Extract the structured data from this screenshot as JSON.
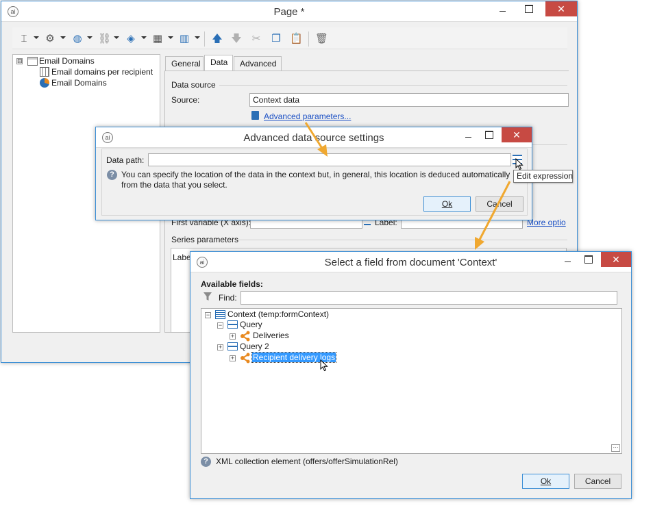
{
  "page_window": {
    "title": "Page *",
    "close_glyph": "✕",
    "tree": [
      {
        "label": "Email Domains",
        "icon": "page-icon",
        "expander": "⊟"
      },
      {
        "label": "Email domains per recipient",
        "icon": "table-icon"
      },
      {
        "label": "Email Domains",
        "icon": "pie-chart-icon"
      }
    ],
    "tabs": [
      "General",
      "Data",
      "Advanced"
    ],
    "data_source_section": "Data source",
    "source_label": "Source:",
    "source_value": "Context data",
    "advanced_link": "Advanced parameters...",
    "first_variable_label": "First variable (X axis):",
    "label_label": "Label:",
    "more_options": "More optio",
    "series_section": "Series parameters",
    "series_column": "Label"
  },
  "advanced_dialog": {
    "title": "Advanced data source settings",
    "data_path_label": "Data path:",
    "data_path_value": "",
    "help_text_1": "You can specify the location of the data in the context but, in general, this location is deduced automatically",
    "help_text_2": "from the data that you select.",
    "ok": "Ok",
    "cancel": "Cancel",
    "tooltip": "Edit expression"
  },
  "field_dialog": {
    "title": "Select a field from document 'Context'",
    "available_fields": "Available fields:",
    "find_label": "Find:",
    "find_value": "",
    "tree": [
      {
        "label": "Context (temp:formContext)",
        "level": 0
      },
      {
        "label": "Query",
        "level": 1
      },
      {
        "label": "Deliveries",
        "level": 2
      },
      {
        "label": "Query 2",
        "level": 1
      },
      {
        "label": "Recipient delivery logs",
        "level": 2,
        "selected": true
      }
    ],
    "xml_hint": "XML collection element (offers/offerSimulationRel)",
    "ok": "Ok",
    "cancel": "Cancel"
  },
  "colors": {
    "accent": "#3c8fd6",
    "close": "#c74a43",
    "link": "#1a4fc4",
    "annotation_arrow": "#f0a830",
    "selection": "#3399ff"
  }
}
